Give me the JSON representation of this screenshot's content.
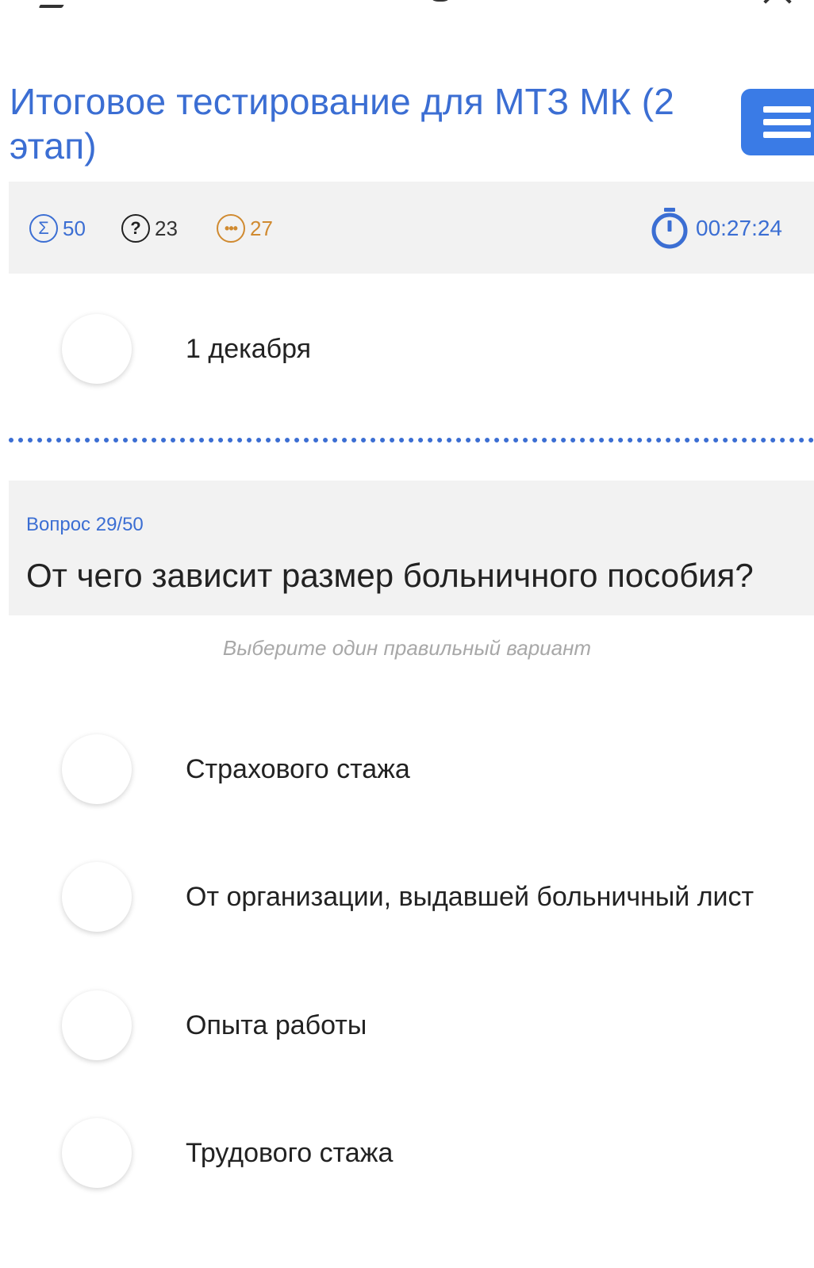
{
  "header": {
    "title": "Итоговое тестирование для МТЗ МК (2 этап)"
  },
  "stats": {
    "total": "50",
    "answered": "23",
    "remaining": "27",
    "timer": "00:27:24"
  },
  "previous_question": {
    "answer_label": "1 декабря"
  },
  "question": {
    "number": "Вопрос 29/50",
    "text": "От чего зависит размер больничного пособия?",
    "instruction": "Выберите один правильный вариант",
    "options": [
      {
        "label": "Страхового стажа"
      },
      {
        "label": "От организации, выдавшей больничный лист"
      },
      {
        "label": "Опыта работы"
      },
      {
        "label": "Трудового стажа"
      }
    ]
  },
  "icons": {
    "total": "sigma-icon",
    "answered": "question-icon",
    "remaining": "more-icon",
    "timer": "stopwatch-icon",
    "menu": "hamburger-menu-icon"
  },
  "colors": {
    "accent": "#3b6ed3",
    "menu_button": "#3a7be6",
    "remaining": "#d08a30",
    "panel_background": "#f2f2f2",
    "instruction": "#a8a8a8"
  }
}
